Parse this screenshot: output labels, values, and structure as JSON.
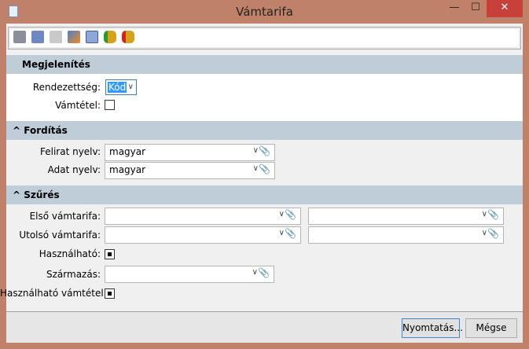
{
  "window": {
    "title": "Vámtarifa",
    "minimize": "—",
    "maximize": "☐",
    "close": "✕"
  },
  "toolbar": {
    "icons": [
      "printer-icon",
      "print-preview-icon",
      "report-icon",
      "edit-icon",
      "calculator-icon",
      "database-import-icon",
      "database-export-icon"
    ]
  },
  "sections": {
    "display": {
      "title": "Megjelenítés",
      "order_label": "Rendezettség:",
      "order_value": "Kód",
      "tariff_item_label": "Vámtétel:"
    },
    "translation": {
      "title": "Fordítás",
      "caption_lang_label": "Felirat nyelv:",
      "caption_lang_value": "magyar",
      "data_lang_label": "Adat nyelv:",
      "data_lang_value": "magyar"
    },
    "filter": {
      "title": "Szűrés",
      "first_label": "Első vámtarifa:",
      "last_label": "Utolsó vámtarifa:",
      "usable_label": "Használható:",
      "origin_label": "Származás:",
      "usable_item_label": "Használható vámtétel:"
    }
  },
  "footer": {
    "print": "Nyomtatás...",
    "cancel": "Mégse"
  }
}
